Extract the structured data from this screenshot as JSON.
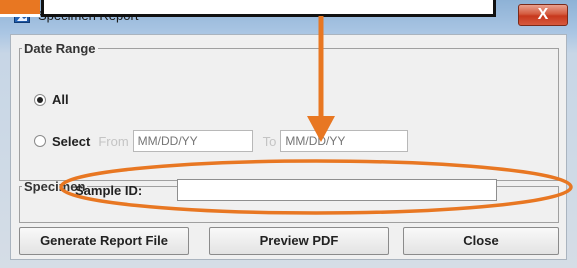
{
  "window": {
    "title": "Specimen Report",
    "close_glyph": "X"
  },
  "date_range": {
    "legend": "Date Range",
    "option_all": "All",
    "option_select": "Select",
    "selected": "All",
    "from_label": "From",
    "from_placeholder": "MM/DD/YY",
    "to_label": "To",
    "to_placeholder": "MM/DD/YY"
  },
  "specimen": {
    "legend": "Specimen",
    "sample_id_label": "Sample ID:",
    "sample_id_value": ""
  },
  "buttons": {
    "generate": "Generate Report File",
    "preview": "Preview PDF",
    "close": "Close"
  },
  "annotation": {
    "color": "#e87722",
    "callout_text": ""
  },
  "icons": {
    "app": "chart-report-icon",
    "close": "close-icon"
  }
}
